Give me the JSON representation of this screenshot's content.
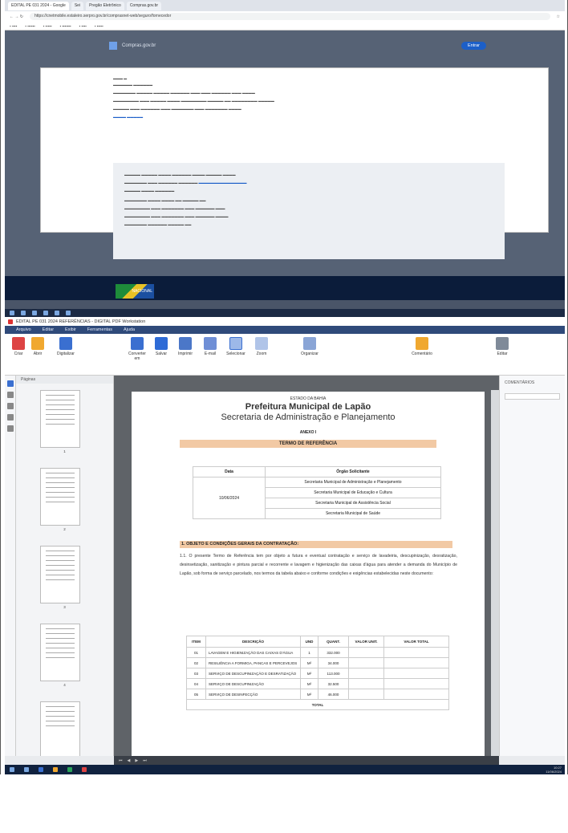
{
  "document": {
    "state": "ESTADO DA BAHIA",
    "municipality": "Prefeitura Municipal de Lapão",
    "secretariat": "Secretaria de Administração e Planejamento",
    "annex": "ANEXO I",
    "term_title": "TERMO DE REFERÊNCIA",
    "date_header": "Data",
    "org_header": "Órgão Solicitante",
    "date_value": "10/06/2024",
    "organs": [
      "Secretaria Municipal de Administração e Planejamento",
      "Secretaria Municipal de Educação e Cultura",
      "Secretaria Municipal de Assistência Social",
      "Secretaria Municipal de Saúde"
    ],
    "section1_title": "1. OBJETO E CONDIÇÕES GERAIS DA CONTRATAÇÃO:",
    "section1_text": "1.1. O presente Termo de Referência tem por objeto a futura e eventual contratação e serviço de lavadeiria, descupinização, desratização, desinsetização, sanitização e pintura parcial e recorrente e lavagem e higienização das caixas d'água para atender a demanda do Município de Lapão, sob forma de serviço parcelado, nos termos da tabela abaixo e conforme condições e exigências estabelecidas neste documento:",
    "items_table": {
      "headers": [
        "ITEM",
        "DESCRIÇÃO",
        "UND",
        "QUANT.",
        "VALOR UNIT.",
        "VALOR TOTAL"
      ],
      "rows": [
        [
          "01",
          "LAVAGEM E HIGIENIZAÇÃO DAS CAIXAS D'ÁGUA",
          "1",
          "332.000",
          "",
          ""
        ],
        [
          "02",
          "RESILIÊNCIA A FORMIGA, PANCAS E PERCEVEJOS",
          "M²",
          "34.000",
          "",
          ""
        ],
        [
          "03",
          "SERVIÇO DE DESCUPINIZAÇÃO E DESRATIZAÇÃO",
          "M²",
          "113.000",
          "",
          ""
        ],
        [
          "04",
          "SERVIÇO DE DESCUPINIZAÇÃO",
          "M²",
          "32.500",
          "",
          ""
        ],
        [
          "05",
          "SERVIÇO DE DESINFECÇÃO",
          "M²",
          "46.000",
          "",
          ""
        ]
      ],
      "total_label": "TOTAL"
    }
  },
  "app": {
    "title": "EDITAL PE 031 2024 REFERÊNCIAS - DIGITAL PDF Workstation",
    "menu": [
      "Arquivo",
      "Editar",
      "Exibir",
      "Ferramentas",
      "Ajuda"
    ],
    "ribbon": {
      "abrir": "Criar",
      "open": "Abrir",
      "digitalizar": "Digitalizar",
      "print_label": "Imprimir",
      "save": "Salvar",
      "email": "E-mail",
      "select": "Selecionar",
      "zoom": "Zoom",
      "convert": "Converter em",
      "organize": "Organizar",
      "comments": "Comentário",
      "edit": "Editar"
    },
    "panel_thumbnails": "Páginas",
    "panel_right": "COMENTÁRIOS",
    "page_numbers": [
      "1",
      "2",
      "3",
      "4",
      "5"
    ]
  },
  "browser": {
    "tabs": [
      "EDITAL PE 031 2024 - Google",
      "Sei",
      "Pregão Eletrônico",
      "Compras.gov.br"
    ],
    "address": "https://cnetmobile.estaleiro.serpro.gov.br/comprasnet-web/seguro/fornecedor",
    "site_title": "Compras.gov.br",
    "button_label": "Entrar",
    "footer_label": "NACIONAL"
  },
  "taskbar": {
    "time": "10:27",
    "date": "11/06/2024"
  },
  "colors": {
    "accent_orange": "#f2c9a4",
    "menubar_blue": "#2f4a7a",
    "taskbar": "#10223f"
  }
}
